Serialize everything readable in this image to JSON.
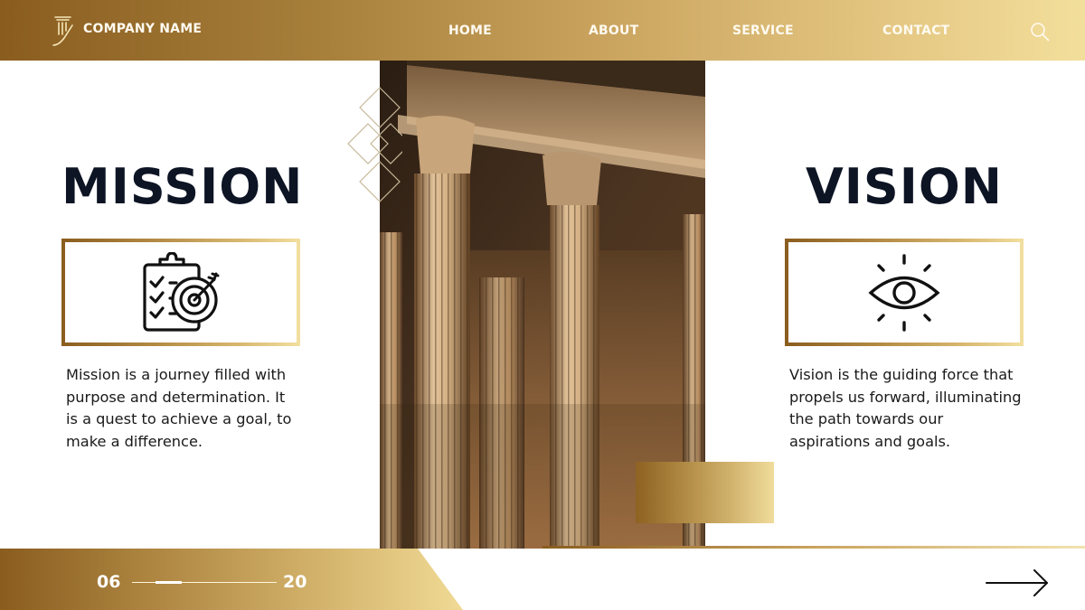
{
  "header": {
    "company_name": "COMPANY NAME",
    "logo_icon": "column-pillar-icon",
    "nav": [
      {
        "label": "HOME"
      },
      {
        "label": "ABOUT"
      },
      {
        "label": "SERVICE"
      },
      {
        "label": "CONTACT"
      }
    ],
    "search_icon": "search-icon"
  },
  "mission": {
    "title": "MISSION",
    "icon": "clipboard-target-icon",
    "description": "Mission is a journey filled with purpose and determination. It is a quest to achieve a goal, to make a difference."
  },
  "vision": {
    "title": "VISION",
    "icon": "eye-icon",
    "description": "Vision is the guiding force that propels us forward, illuminating the path towards our aspirations and goals."
  },
  "photo": {
    "subject": "classical-columns-photo"
  },
  "footer": {
    "page_current": "06",
    "page_total": "20",
    "progress_fraction": 0.3,
    "next_icon": "arrow-right-icon"
  },
  "colors": {
    "gold_dark": "#8a5d1f",
    "gold_mid": "#c9a35e",
    "gold_light": "#f3df9c",
    "title_navy": "#0d1424",
    "body_text": "#1a1a1a"
  }
}
